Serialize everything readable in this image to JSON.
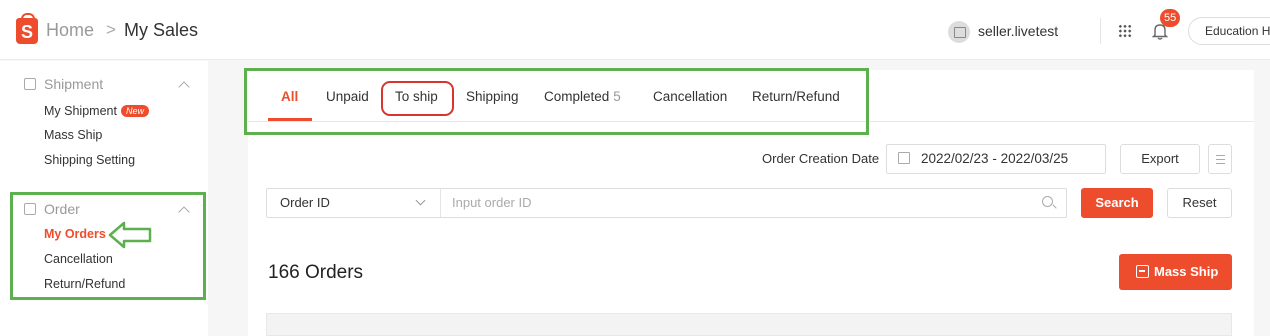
{
  "breadcrumb": {
    "home": "Home",
    "separator": ">",
    "current": "My Sales"
  },
  "header": {
    "logo_letter": "S",
    "username": "seller.livetest",
    "notification_count": "55",
    "education_label": "Education Hub"
  },
  "sidebar": {
    "sections": [
      {
        "title": "Shipment",
        "items": [
          "My Shipment",
          "Mass Ship",
          "Shipping Setting"
        ],
        "new_badge": "New"
      },
      {
        "title": "Order",
        "items": [
          "My Orders",
          "Cancellation",
          "Return/Refund"
        ]
      }
    ]
  },
  "tabs": [
    {
      "label": "All"
    },
    {
      "label": "Unpaid"
    },
    {
      "label": "To ship"
    },
    {
      "label": "Shipping"
    },
    {
      "label": "Completed",
      "count": "5"
    },
    {
      "label": "Cancellation"
    },
    {
      "label": "Return/Refund"
    }
  ],
  "date_filter": {
    "label": "Order Creation Date",
    "value": "2022/02/23 - 2022/03/25"
  },
  "buttons": {
    "export": "Export",
    "search": "Search",
    "reset": "Reset",
    "mass_ship": "Mass Ship"
  },
  "search": {
    "type": "Order ID",
    "placeholder": "Input order ID"
  },
  "orders_count": "166 Orders",
  "colors": {
    "accent": "#ee4d2d",
    "annotation_green": "#5cb14e",
    "annotation_red": "#d6362e"
  }
}
